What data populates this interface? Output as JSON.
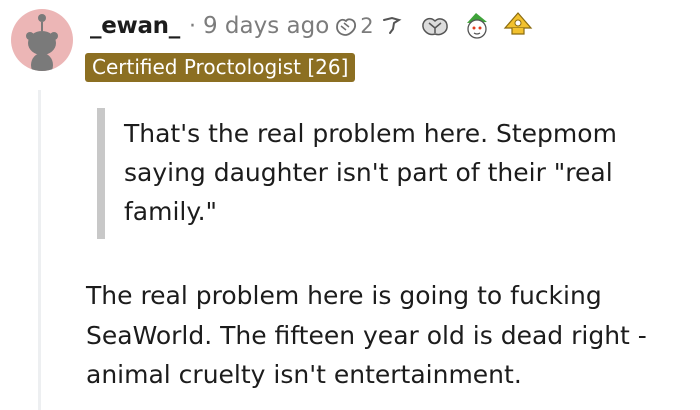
{
  "comment": {
    "author": "_ewan_",
    "separator": "·",
    "timestamp": "9 days ago",
    "flair": "Certified Proctologist [26]",
    "awards": [
      {
        "icon": "hands-award-icon",
        "count": "2"
      },
      {
        "icon": "facepalm-award-icon",
        "count": ""
      },
      {
        "icon": "fist-bump-award-icon",
        "count": ""
      },
      {
        "icon": "snoo-elf-award-icon",
        "count": ""
      },
      {
        "icon": "tinfoil-hat-award-icon",
        "count": ""
      }
    ],
    "quote": "That's the real problem here. Stepmom saying daughter isn't part of their \"real family.\"",
    "body": "The real problem here is going to fucking SeaWorld. The fifteen year old is dead right - animal cruelty isn't entertainment."
  },
  "colors": {
    "avatar_bg": "#ecb6b6",
    "flair_bg": "#8c6f22",
    "meta_text": "#7c7c7c",
    "quote_bar": "#c8c8c8",
    "thread_line": "#edeff1"
  }
}
